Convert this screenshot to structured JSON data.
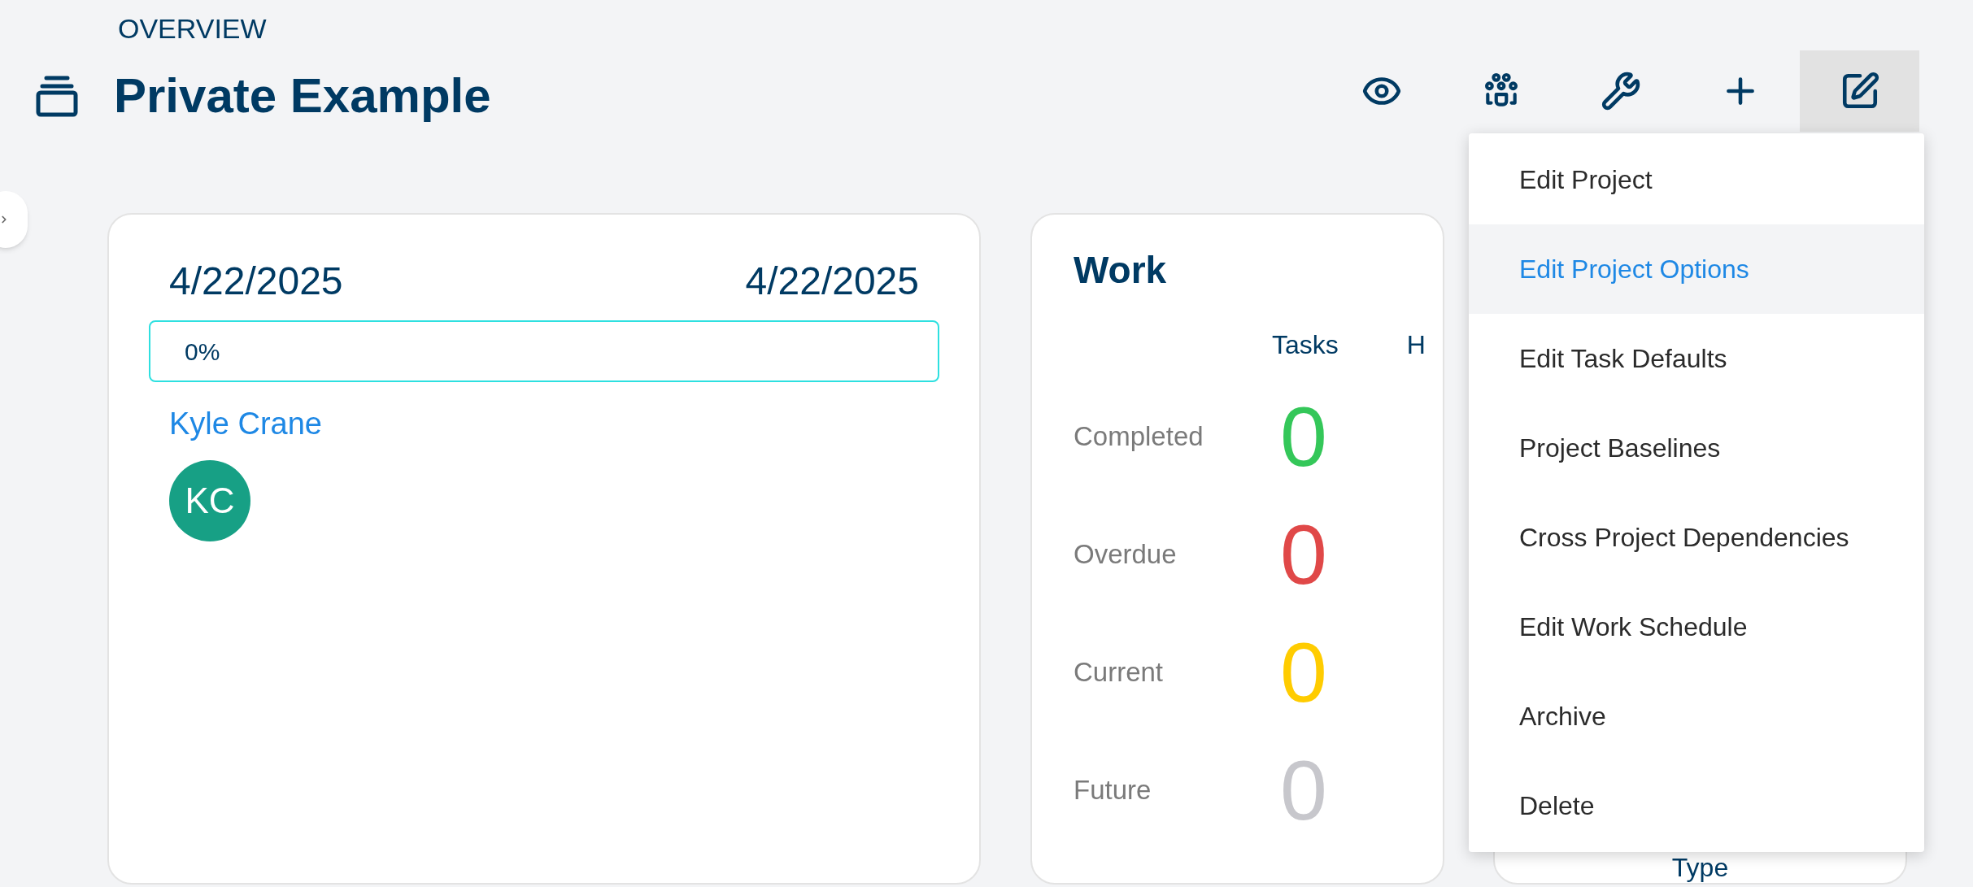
{
  "header": {
    "breadcrumb": "OVERVIEW",
    "title": "Private Example"
  },
  "toolbar": [
    {
      "kind": "eye",
      "selected": false
    },
    {
      "kind": "team",
      "selected": false
    },
    {
      "kind": "wrench",
      "selected": false
    },
    {
      "kind": "plus",
      "selected": false
    },
    {
      "kind": "edit",
      "selected": true
    }
  ],
  "menu": {
    "items": [
      {
        "label": "Edit Project",
        "selected": false
      },
      {
        "label": "Edit Project Options",
        "selected": true
      },
      {
        "label": "Edit Task Defaults",
        "selected": false
      },
      {
        "label": "Project Baselines",
        "selected": false
      },
      {
        "label": "Cross Project Dependencies",
        "selected": false
      },
      {
        "label": "Edit Work Schedule",
        "selected": false
      },
      {
        "label": "Archive",
        "selected": false
      },
      {
        "label": "Delete",
        "selected": false
      }
    ]
  },
  "schedule_card": {
    "start_date": "4/22/2025",
    "end_date": "4/22/2025",
    "progress": {
      "label": "0%",
      "level": 0
    },
    "owner": {
      "name": "Kyle Crane",
      "initials": "KC"
    }
  },
  "work_card": {
    "title": "Work",
    "columns": [
      "Tasks",
      "H"
    ],
    "rows": [
      {
        "label": "Completed",
        "value": "0",
        "color": "#34c759"
      },
      {
        "label": "Overdue",
        "value": "0",
        "color": "#e04848"
      },
      {
        "label": "Current",
        "value": "0",
        "color": "#ffcc00"
      },
      {
        "label": "Future",
        "value": "0",
        "color": "#c7c7cc"
      }
    ]
  },
  "type_card": {
    "label": "Type"
  }
}
